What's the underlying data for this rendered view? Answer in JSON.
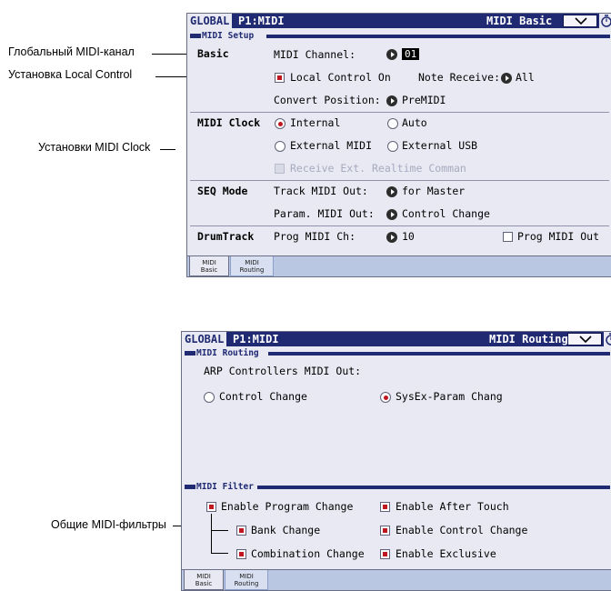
{
  "callouts": {
    "global_channel": "Глобальный MIDI-канал",
    "local_control": "Установка Local Control",
    "midi_clock": "Установки MIDI Clock",
    "midi_filters": "Общие MIDI-фильтры"
  },
  "screen1": {
    "mode": "GLOBAL",
    "page": "P1:MIDI",
    "name": "MIDI Basic",
    "section": "MIDI Setup",
    "basic": {
      "label": "Basic",
      "midi_channel_label": "MIDI Channel:",
      "midi_channel_value": "01",
      "local_control_label": "Local Control On",
      "local_control_checked": true,
      "note_receive_label": "Note Receive:",
      "note_receive_value": "All",
      "convert_position_label": "Convert Position:",
      "convert_position_value": "PreMIDI"
    },
    "midi_clock": {
      "label": "MIDI Clock",
      "options": [
        "Internal",
        "Auto",
        "External MIDI",
        "External USB"
      ],
      "selected": "Internal",
      "receive_ext_label": "Receive Ext. Realtime Comman"
    },
    "seq_mode": {
      "label": "SEQ Mode",
      "track_out_label": "Track MIDI Out:",
      "track_out_value": "for Master",
      "param_out_label": "Param. MIDI Out:",
      "param_out_value": "Control Change"
    },
    "drumtrack": {
      "label": "DrumTrack",
      "prog_ch_label": "Prog MIDI Ch:",
      "prog_ch_value": "10",
      "prog_out_label": "Prog MIDI Out",
      "prog_out_checked": false
    },
    "tabs": [
      {
        "line1": "MIDI",
        "line2": "Basic",
        "active": true
      },
      {
        "line1": "MIDI",
        "line2": "Routing",
        "active": false
      }
    ]
  },
  "screen2": {
    "mode": "GLOBAL",
    "page": "P1:MIDI",
    "name": "MIDI Routing",
    "routing_section": "MIDI Routing",
    "arp_label": "ARP Controllers MIDI Out:",
    "arp_options": [
      "Control Change",
      "SysEx-Param Chang"
    ],
    "arp_selected": "SysEx-Param Chang",
    "filter_section": "MIDI Filter",
    "filters": {
      "program_change": "Enable Program Change",
      "bank_change": "Bank Change",
      "combination_change": "Combination Change",
      "after_touch": "Enable After Touch",
      "control_change": "Enable Control Change",
      "exclusive": "Enable Exclusive"
    },
    "tabs": [
      {
        "line1": "MIDI",
        "line2": "Basic",
        "active": true
      },
      {
        "line1": "MIDI",
        "line2": "Routing",
        "active": false
      }
    ]
  },
  "colors": {
    "titlebar": "#1f2a73",
    "screen_bg": "#e8e9f2",
    "checked_red": "#c0161f",
    "tabbar": "#b9c7e3"
  }
}
